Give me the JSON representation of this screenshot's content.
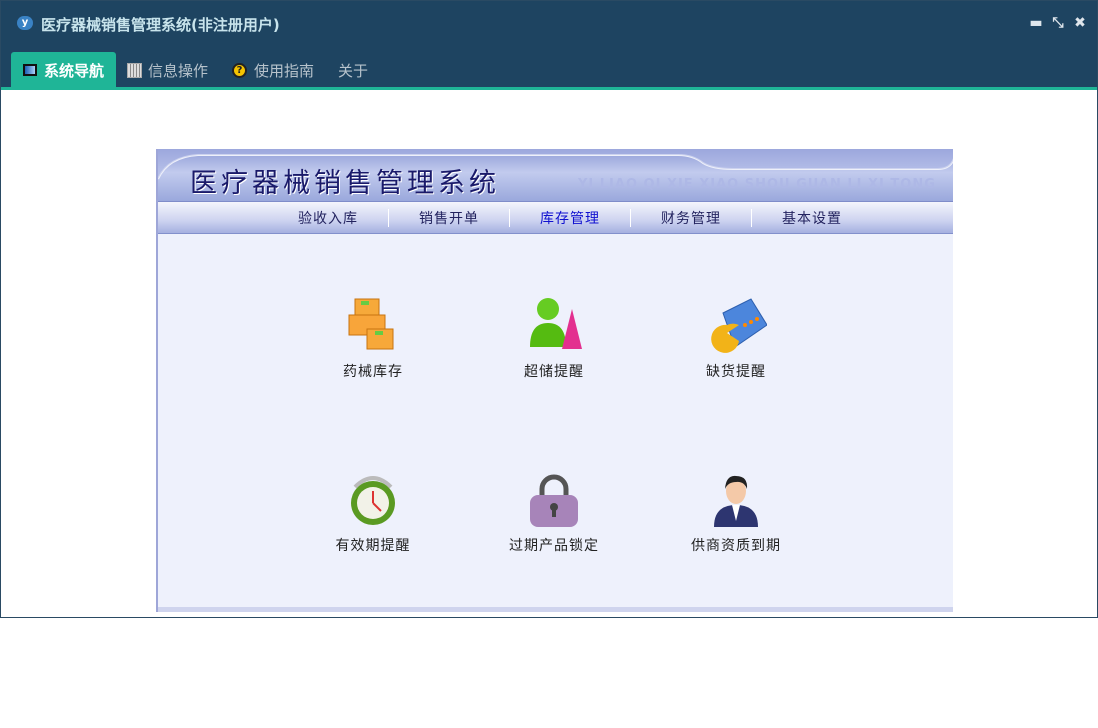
{
  "window": {
    "title": "医疗器械销售管理系统(非注册用户)",
    "logo": "yf",
    "controls": [
      "minimize-icon",
      "restore-icon",
      "close-icon"
    ]
  },
  "tabs": [
    {
      "label": "系统导航",
      "icon": "monitor-icon"
    },
    {
      "label": "信息操作",
      "icon": "grid-icon"
    },
    {
      "label": "使用指南",
      "icon": "help-icon"
    },
    {
      "label": "关于"
    }
  ],
  "banner": {
    "title": "医疗器械销售管理系统",
    "subtitle": "YI LIAO QI XIE XIAO SHOU GUAN LI XI TONG"
  },
  "nav": [
    "验收入库",
    "销售开单",
    "库存管理",
    "财务管理",
    "基本设置"
  ],
  "nav_current": "库存管理",
  "functions": [
    {
      "label": "药械库存",
      "icon": "boxes-icon"
    },
    {
      "label": "超储提醒",
      "icon": "user-party-icon"
    },
    {
      "label": "缺货提醒",
      "icon": "book-pacman-icon"
    },
    {
      "label": "有效期提醒",
      "icon": "alarm-clock-icon"
    },
    {
      "label": "过期产品锁定",
      "icon": "padlock-icon"
    },
    {
      "label": "供商资质到期",
      "icon": "businessman-icon"
    }
  ]
}
